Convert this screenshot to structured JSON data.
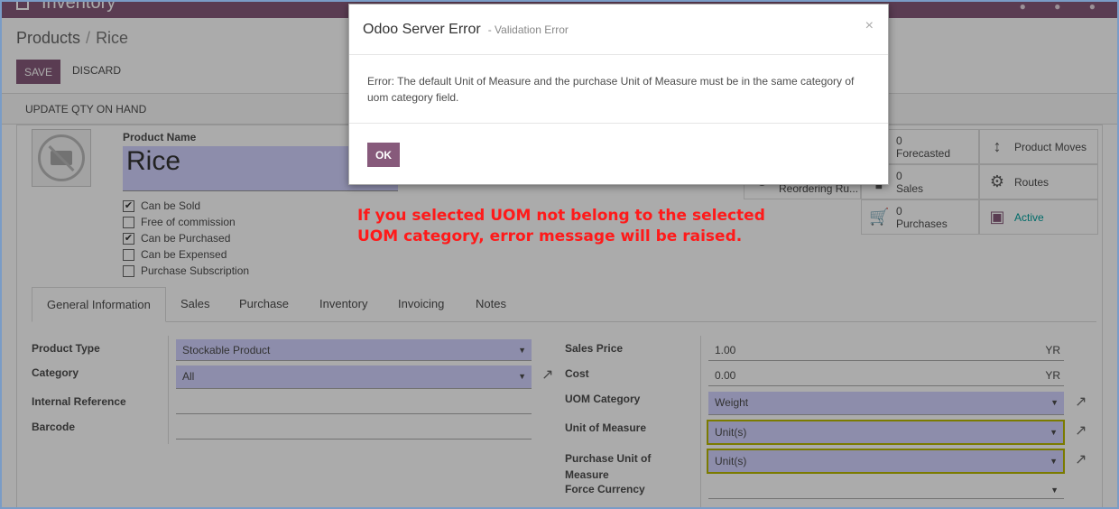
{
  "app": {
    "title": "Inventory"
  },
  "breadcrumb": {
    "parent": "Products",
    "separator": "/",
    "current": "Rice"
  },
  "toolbar": {
    "save_label": "SAVE",
    "discard_label": "DISCARD"
  },
  "statusbar": {
    "update_qty_label": "UPDATE QTY ON HAND"
  },
  "product": {
    "name_label": "Product Name",
    "name": "Rice",
    "checks": [
      {
        "label": "Can be Sold",
        "checked": true,
        "mark": "✔"
      },
      {
        "label": "Free of commission",
        "checked": false,
        "mark": ""
      },
      {
        "label": "Can be Purchased",
        "checked": true,
        "mark": "✔"
      },
      {
        "label": "Can be Expensed",
        "checked": false,
        "mark": ""
      },
      {
        "label": "Purchase Subscription",
        "checked": false,
        "mark": ""
      }
    ]
  },
  "smart_buttons": {
    "forecasted": {
      "count": "0",
      "label": "Forecasted",
      "icon": "area-chart-icon"
    },
    "product_moves": {
      "label": "Product Moves",
      "icon": "arrows-v-icon"
    },
    "reordering": {
      "label": "Reordering Ru...",
      "icon": "refresh-icon"
    },
    "sales": {
      "count": "0",
      "label": "Sales",
      "icon": "signal-icon"
    },
    "routes": {
      "label": "Routes",
      "icon": "cogs-icon"
    },
    "purchases": {
      "count": "0",
      "label": "Purchases",
      "icon": "shopping-cart-icon"
    },
    "active": {
      "label": "Active",
      "icon": "archive-icon",
      "color": "#00a09d"
    }
  },
  "tabs": [
    "General Information",
    "Sales",
    "Purchase",
    "Inventory",
    "Invoicing",
    "Notes"
  ],
  "general": {
    "product_type_label": "Product Type",
    "product_type": "Stockable Product",
    "category_label": "Category",
    "category": "All",
    "internal_ref_label": "Internal Reference",
    "internal_ref": "",
    "barcode_label": "Barcode",
    "barcode": "",
    "sales_price_label": "Sales Price",
    "sales_price": "1.00",
    "currency": "YR",
    "cost_label": "Cost",
    "cost": "0.00",
    "uom_category_label": "UOM Category",
    "uom_category": "Weight",
    "uom_label": "Unit of Measure",
    "uom": "Unit(s)",
    "purchase_uom_label_1": "Purchase Unit of",
    "purchase_uom_label_2": "Measure",
    "purchase_uom": "Unit(s)",
    "force_currency_label": "Force Currency",
    "force_currency": ""
  },
  "dialog": {
    "title": "Odoo Server Error",
    "subtitle": "- Validation Error",
    "close": "×",
    "message": "Error: The default Unit of Measure and the purchase Unit of Measure must be in the same category of uom category field.",
    "ok_label": "OK"
  },
  "annotation": {
    "line1": "If you selected UOM not belong to the selected",
    "line2": "UOM category, error message will be raised.",
    "color": "#ff1a1a"
  },
  "colors": {
    "brand": "#875a7b",
    "input_highlight": "#d2d2ff",
    "uom_border": "#b8b800"
  }
}
